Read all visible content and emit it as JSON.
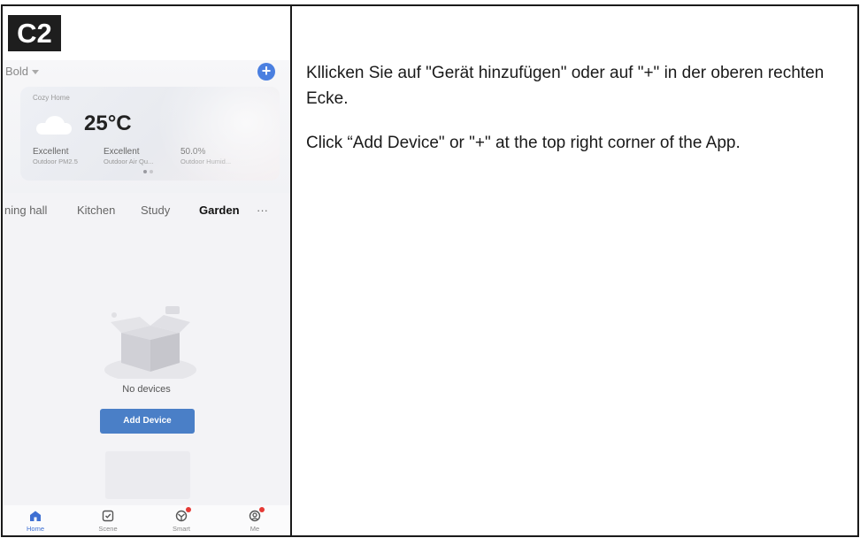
{
  "step": {
    "label": "C2"
  },
  "app": {
    "home_selector": "Bold",
    "add_button": "+",
    "weather": {
      "home_name": "Cozy Home",
      "temperature": "25°C",
      "stats": [
        {
          "value": "Excellent",
          "label": "Outdoor PM2.5"
        },
        {
          "value": "Excellent",
          "label": "Outdoor Air Qu..."
        },
        {
          "value": "50.0%",
          "label": "Outdoor Humid..."
        }
      ]
    },
    "rooms": [
      "ning hall",
      "Kitchen",
      "Study",
      "Garden",
      "···"
    ],
    "active_room": "Garden",
    "empty_state": {
      "message": "No devices",
      "button": "Add Device"
    },
    "tabbar": [
      {
        "label": "Home",
        "icon": "home-icon",
        "active": true
      },
      {
        "label": "Scene",
        "icon": "scene-icon",
        "active": false
      },
      {
        "label": "Smart",
        "icon": "smart-icon",
        "active": false
      },
      {
        "label": "Me",
        "icon": "me-icon",
        "active": false
      }
    ],
    "colors": {
      "accent": "#4a7fc7",
      "active_tab": "#3e6fd2",
      "notification": "#e53935"
    }
  },
  "instructions": {
    "de": "Kllicken Sie auf \"Gerät hinzufügen\" oder auf \"+\" in der oberen rechten Ecke.",
    "en": "Click “Add Device\" or \"+\" at the top right corner of the App."
  }
}
